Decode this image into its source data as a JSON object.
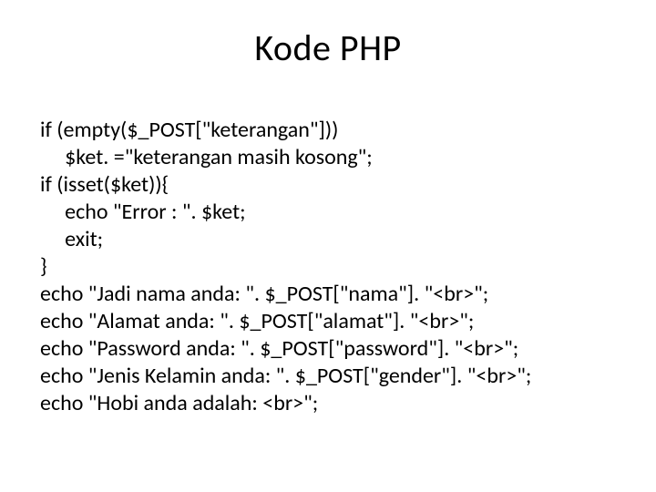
{
  "title": "Kode PHP",
  "code_lines": [
    "if (empty($_POST[\"keterangan\"]))",
    "     $ket. =\"keterangan masih kosong\";",
    "if (isset($ket)){",
    "     echo \"Error : \". $ket;",
    "     exit;",
    "}",
    "echo \"Jadi nama anda: \". $_POST[\"nama\"]. \"<br>\";",
    "echo \"Alamat anda: \". $_POST[\"alamat\"]. \"<br>\";",
    "echo \"Password anda: \". $_POST[\"password\"]. \"<br>\";",
    "echo \"Jenis Kelamin anda: \". $_POST[\"gender\"]. \"<br>\";",
    "echo \"Hobi anda adalah: <br>\";"
  ]
}
